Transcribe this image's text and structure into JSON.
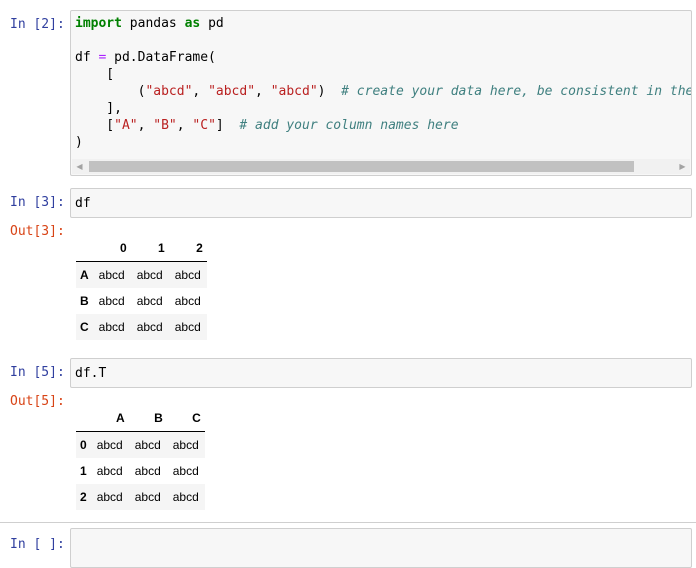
{
  "cells": [
    {
      "in_prompt": "In [2]:",
      "code_lines": [
        {
          "parts": [
            [
              "kw",
              "import"
            ],
            [
              "t",
              " pandas "
            ],
            [
              "kw",
              "as"
            ],
            [
              "t",
              " pd"
            ]
          ]
        },
        {
          "parts": [
            [
              "t",
              ""
            ]
          ]
        },
        {
          "parts": [
            [
              "t",
              "df "
            ],
            [
              "op",
              "="
            ],
            [
              "t",
              " pd.DataFrame("
            ]
          ]
        },
        {
          "parts": [
            [
              "t",
              "    ["
            ]
          ]
        },
        {
          "parts": [
            [
              "t",
              "        ("
            ],
            [
              "str",
              "\"abcd\""
            ],
            [
              "t",
              ", "
            ],
            [
              "str",
              "\"abcd\""
            ],
            [
              "t",
              ", "
            ],
            [
              "str",
              "\"abcd\""
            ],
            [
              "t",
              ")  "
            ],
            [
              "com",
              "# create your data here, be consistent in the"
            ]
          ]
        },
        {
          "parts": [
            [
              "t",
              "    ],"
            ]
          ]
        },
        {
          "parts": [
            [
              "t",
              "    ["
            ],
            [
              "str",
              "\"A\""
            ],
            [
              "t",
              ", "
            ],
            [
              "str",
              "\"B\""
            ],
            [
              "t",
              ", "
            ],
            [
              "str",
              "\"C\""
            ],
            [
              "t",
              "]  "
            ],
            [
              "com",
              "# add your column names here"
            ]
          ]
        },
        {
          "parts": [
            [
              "t",
              ")"
            ]
          ]
        }
      ]
    },
    {
      "in_prompt": "In [3]:",
      "code": "df",
      "out_prompt": "Out[3]:",
      "table": {
        "columns": [
          "",
          "0",
          "1",
          "2"
        ],
        "rows": [
          {
            "index": "A",
            "values": [
              "abcd",
              "abcd",
              "abcd"
            ]
          },
          {
            "index": "B",
            "values": [
              "abcd",
              "abcd",
              "abcd"
            ]
          },
          {
            "index": "C",
            "values": [
              "abcd",
              "abcd",
              "abcd"
            ]
          }
        ]
      }
    },
    {
      "in_prompt": "In [5]:",
      "code": "df.T",
      "out_prompt": "Out[5]:",
      "table": {
        "columns": [
          "",
          "A",
          "B",
          "C"
        ],
        "rows": [
          {
            "index": "0",
            "values": [
              "abcd",
              "abcd",
              "abcd"
            ]
          },
          {
            "index": "1",
            "values": [
              "abcd",
              "abcd",
              "abcd"
            ]
          },
          {
            "index": "2",
            "values": [
              "abcd",
              "abcd",
              "abcd"
            ]
          }
        ]
      }
    },
    {
      "in_prompt": "In [ ]:",
      "code": ""
    }
  ],
  "icons": {
    "scroll_left": "◀",
    "scroll_right": "▶"
  }
}
